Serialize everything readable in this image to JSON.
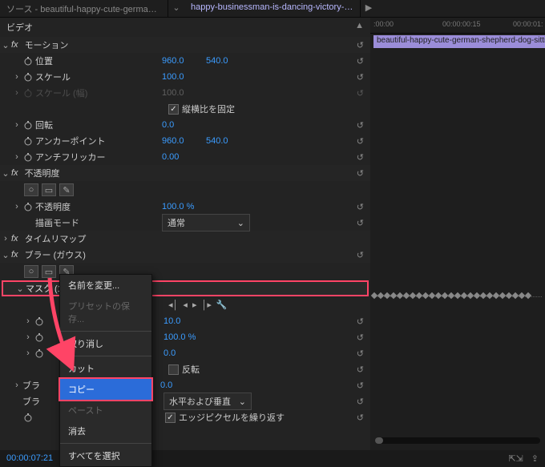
{
  "tabs": {
    "source": "ソース - beautiful-happy-cute-german-shephe...",
    "effect": "happy-businessman-is-dancing-victory-da..."
  },
  "panel": {
    "title": "ビデオ",
    "menu_icon": "hamburger-icon"
  },
  "ruler": {
    "t0": ":00:00",
    "t1": "00:00:00:15",
    "t2": "00:00:01:"
  },
  "clip": {
    "name": "beautiful-happy-cute-german-shepherd-dog-sitting-still-"
  },
  "effects": {
    "motion": {
      "label": "モーション",
      "position": {
        "label": "位置",
        "x": "960.0",
        "y": "540.0"
      },
      "scale": {
        "label": "スケール",
        "v": "100.0"
      },
      "scale_w": {
        "label": "スケール (幅)",
        "v": "100.0"
      },
      "lock_ratio": "縦横比を固定",
      "rotation": {
        "label": "回転",
        "v": "0.0"
      },
      "anchor": {
        "label": "アンカーポイント",
        "x": "960.0",
        "y": "540.0"
      },
      "antiflicker": {
        "label": "アンチフリッカー",
        "v": "0.00"
      }
    },
    "opacity": {
      "label": "不透明度",
      "value": {
        "label": "不透明度",
        "v": "100.0 %"
      },
      "blend": {
        "label": "描画モード",
        "v": "通常"
      }
    },
    "timeremap": {
      "label": "タイムリマップ"
    },
    "blur": {
      "label": "ブラー (ガウス)",
      "mask": {
        "label": "マスク (1)"
      },
      "p1": "10.0",
      "p2": "100.0 %",
      "p3": "0.0",
      "invert": "反転",
      "p4": "0.0",
      "dim": "水平および垂直",
      "repeat_edge": "エッジピクセルを繰り返す",
      "hidden1": "ブラ",
      "hidden2": "ブラ"
    }
  },
  "context": {
    "rename": "名前を変更...",
    "save_preset": "プリセットの保存...",
    "undo": "取り消し",
    "cut": "カット",
    "copy": "コピー",
    "paste": "ペースト",
    "clear": "消去",
    "select_all": "すべてを選択"
  },
  "status": {
    "timecode": "00:00:07:21"
  },
  "fx": "fx"
}
